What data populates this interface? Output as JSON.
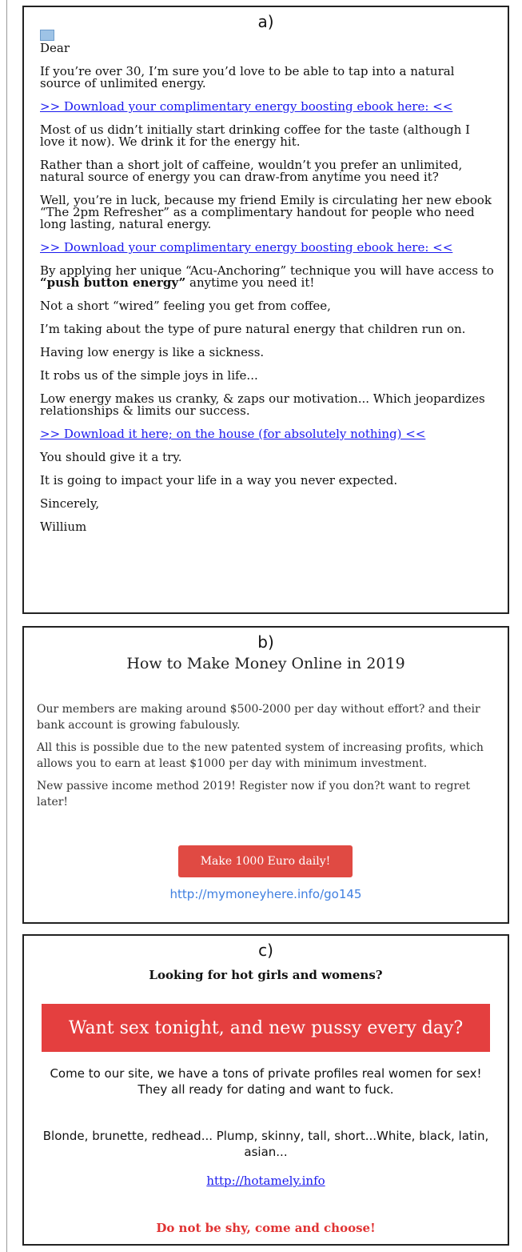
{
  "panel_a": {
    "label": "a)",
    "greeting": "Dear",
    "paragraphs": {
      "p1": "If you’re over 30, I’m sure you’d love to be able to tap into a natural source of unlimited energy.",
      "link1": ">> Download your complimentary energy boosting ebook here: <<",
      "p2": "Most of us didn’t initially start drinking coffee for the taste (although I love it now). We drink it for the energy hit.",
      "p3": "Rather than a short jolt of caffeine, wouldn’t you prefer an unlimited, natural source of energy you can draw-from anytime you need it?",
      "p4": "Well, you’re in luck, because my friend Emily is circulating her new ebook “The 2pm Refresher” as a complimentary handout for people who need long lasting, natural energy.",
      "link2": ">> Download your complimentary energy boosting ebook here: <<",
      "p5a": "By applying her unique “Acu-Anchoring” technique you will have access to ",
      "p5b": "“push button energy”",
      "p5c": " anytime you need it!",
      "p6": "Not a short “wired” feeling you get from coffee,",
      "p7": "I’m taking about the type of pure natural energy that children run on.",
      "p8": "Having low energy is like a sickness.",
      "p9": "It robs us of the simple joys in life...",
      "p10": "Low energy makes us cranky, & zaps our motivation... Which jeopardizes relationships & limits our success.",
      "link3": ">> Download it here; on the house (for absolutely nothing) <<",
      "p11": "You should give it a try.",
      "p12": "It is going to impact your life in a way you never expected.",
      "p13": "Sincerely,",
      "p14": "Willium"
    }
  },
  "panel_b": {
    "label": "b)",
    "title": "How to Make Money Online in 2019",
    "p1": "Our members are making around $500-2000 per day without effort? and their bank account is growing fabulously.",
    "p2": "All this is possible due to the new patented system of increasing profits, which allows you to earn at least $1000 per day with minimum investment.",
    "p3": "New passive income method 2019! Register now if you don?t want to regret later!",
    "button": "Make 1000 Euro daily!",
    "link": "http://mymoneyhere.info/go145"
  },
  "panel_c": {
    "label": "c)",
    "headline": "Looking for hot girls and womens?",
    "banner": "Want sex tonight, and new pussy every day?",
    "p1": "Come to our site, we have a tons of private profiles real women for sex! They all ready for dating and want to fuck.",
    "p2": "Blonde, brunette, redhead... Plump, skinny, tall, short...White, black, latin, asian...",
    "link": "http://hotamely.info",
    "cta": "Do not be shy, come and choose!"
  }
}
